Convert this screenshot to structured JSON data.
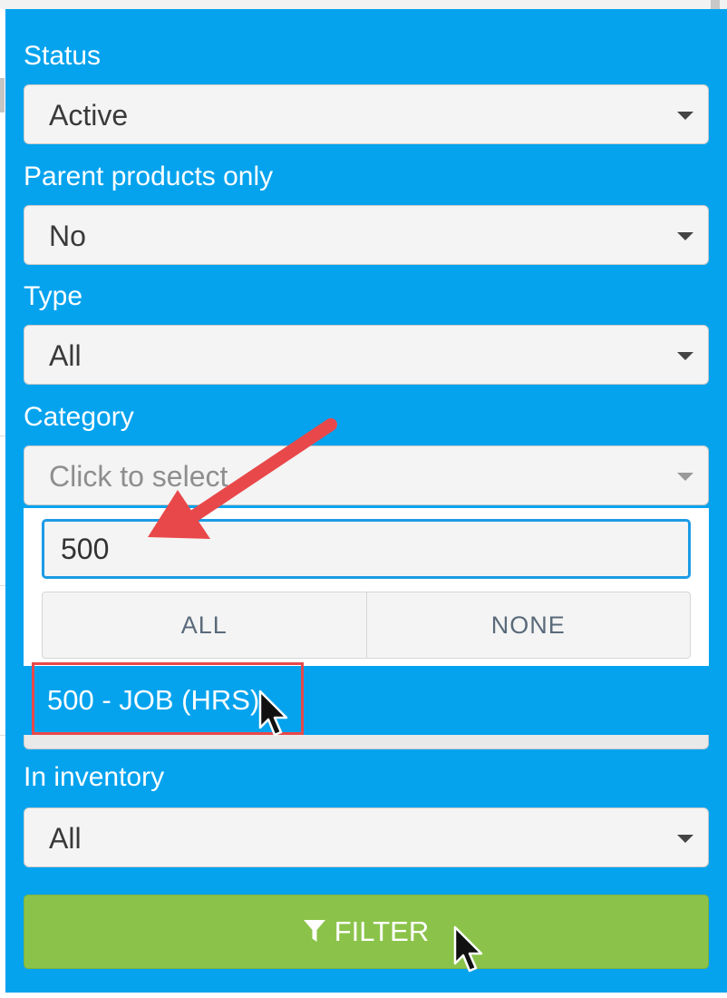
{
  "filters": {
    "status": {
      "label": "Status",
      "value": "Active"
    },
    "parent_products_only": {
      "label": "Parent products only",
      "value": "No"
    },
    "type": {
      "label": "Type",
      "value": "All"
    },
    "category": {
      "label": "Category",
      "placeholder": "Click to select"
    },
    "in_inventory": {
      "label": "In inventory",
      "value": "All"
    }
  },
  "category_dropdown": {
    "search_value": "500",
    "all_label": "ALL",
    "none_label": "NONE",
    "options": [
      "500 - JOB (HRS)"
    ]
  },
  "filter_button": {
    "label": "FILTER",
    "icon": "funnel-icon"
  },
  "annotations": {
    "arrow_color": "#e8484a",
    "highlight_color": "#e8484a"
  },
  "colors": {
    "panel": "#05a3ee",
    "filter_button": "#8bc34a",
    "search_border": "#1c9be6"
  }
}
